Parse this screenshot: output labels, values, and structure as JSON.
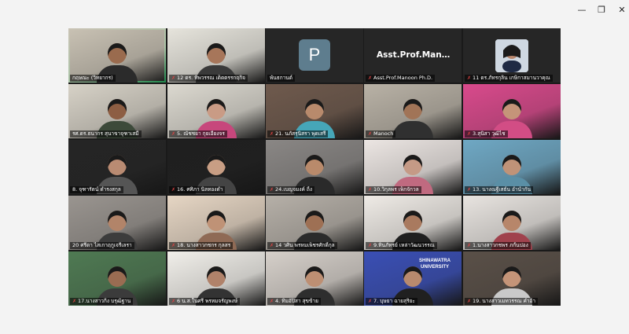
{
  "window": {
    "minimize_icon": "—",
    "maximize_icon": "❐",
    "close_icon": "✕"
  },
  "colors": {
    "active_speaker_border": "#2ecc71",
    "mic_muted": "#e04343",
    "avatar_bg": "#5e7d8e"
  },
  "participants": [
    {
      "name": "กฤษณะ (วิทยากร)",
      "muted": false,
      "bg": "#c9c2b4",
      "skin": "#9a6b4e",
      "shirt": "#2b2b2b",
      "active": true
    },
    {
      "name": "12 ดร. ทิพวรรณ เด็ดตรรกฤกิจ",
      "muted": true,
      "bg": "#e6e4dc",
      "skin": "#a7765a",
      "shirt": "#3a3a3a"
    },
    {
      "name": "พันธกานต์",
      "muted": false,
      "type": "letter",
      "letter": "P"
    },
    {
      "name": "Asst.Prof.Manoon Ph.D.",
      "muted": true,
      "type": "bigname",
      "display": "Asst.Prof.Mano..."
    },
    {
      "name": "11 ดร.ภัทรกุลิน  เกษิกาสมานวาคุณ",
      "muted": true,
      "type": "photo"
    },
    {
      "name": "รศ.ดร.ธนากร สุนาขาจุฑาเสมี",
      "muted": false,
      "bg": "#d7d2c7",
      "skin": "#8d5e43",
      "shirt": "#3d4a3a"
    },
    {
      "name": "5. ณัชชยา กุยเอียงจร",
      "muted": true,
      "bg": "#dcd9d0",
      "skin": "#c99b85",
      "shirt": "#c7477c"
    },
    {
      "name": "21. นภัสรุนิสรา พุดเสรี",
      "muted": true,
      "bg": "#6f5a4d",
      "skin": "#b88a6c",
      "shirt": "#46a6b8"
    },
    {
      "name": "Manoch",
      "muted": true,
      "bg": "#b9b2a6",
      "skin": "#a17457",
      "shirt": "#303030"
    },
    {
      "name": "3.สุนิสา วุฒิไช",
      "muted": true,
      "bg": "#d94a8c",
      "skin": "#c59479",
      "shirt": "#d24d85"
    },
    {
      "name": "8. จุฑารัตน์ ดำรงสกุล",
      "muted": false,
      "bg": "#252525",
      "skin": "#b98b72",
      "shirt": "#555555"
    },
    {
      "name": "16. ศศิภา นิลทองดำ",
      "muted": true,
      "bg": "#1f1f1f",
      "skin": "#c89e84",
      "shirt": "#444444"
    },
    {
      "name": "24.เบญจมงค์ ถิ้ง",
      "muted": true,
      "bg": "#8a8785",
      "skin": "#b98a6b",
      "shirt": "#2a2a2a"
    },
    {
      "name": "10.วิกุลพร เพ็กจักวล",
      "muted": true,
      "bg": "#ece6e3",
      "skin": "#c59a86",
      "shirt": "#c06a80"
    },
    {
      "name": "13. นางณฐีเสธ์น อำนำกัน",
      "muted": true,
      "bg": "#6fa8c4",
      "skin": "#c09378",
      "shirt": "#5a8fa6"
    },
    {
      "name": "20 ศรีดา ไสเกาฤกูเจรีเลรา",
      "muted": false,
      "bg": "#9a9590",
      "skin": "#b28469",
      "shirt": "#3c3c3c"
    },
    {
      "name": "18. นางสาวกชกร กุลสร",
      "muted": true,
      "bg": "#e6d6c4",
      "skin": "#bf9276",
      "shirt": "#8f6a55"
    },
    {
      "name": "14 วศิน พรหมเพ็ชรศักดิ์กุล",
      "muted": true,
      "bg": "#b6b0a8",
      "skin": "#9e7054",
      "shirt": "#2b2b2b"
    },
    {
      "name": "9.ทินภัทรย์ เหล่าวัฒนวรรณ",
      "muted": true,
      "bg": "#efebe6",
      "skin": "#a97a5f",
      "shirt": "#1f1f1f"
    },
    {
      "name": "1.นางสาวกชพร ภกั้นปอง",
      "muted": true,
      "bg": "#e8e4e0",
      "skin": "#b7866a",
      "shirt": "#a0424d"
    },
    {
      "name": "17.นางสาวกิ่ง บรุฒิฐาน",
      "muted": true,
      "bg": "#4f7a53",
      "skin": "#9a6c52",
      "shirt": "#3b3b3b"
    },
    {
      "name": "6 น.ส.ในศรี พรหมจรัญพงษ์",
      "muted": true,
      "bg": "#f1efea",
      "skin": "#b0826a",
      "shirt": "#333333"
    },
    {
      "name": "4. ทิมอัปิสา สุขข้าย",
      "muted": true,
      "bg": "#d6d0ca",
      "skin": "#bd8f73",
      "shirt": "#2e2e2e"
    },
    {
      "name": "7. บุษยา ฉายสุริยะ",
      "muted": true,
      "bg": "#3a4fb5",
      "skin": "#b88a6e",
      "shirt": "#202020",
      "overlay": "SHINAWATRA UNIVERSITY"
    },
    {
      "name": "19. นางสาวเมทวรรณ คำอ้า",
      "muted": true,
      "bg": "#5a5048",
      "skin": "#c49478",
      "shirt": "#c9c9c9"
    }
  ]
}
